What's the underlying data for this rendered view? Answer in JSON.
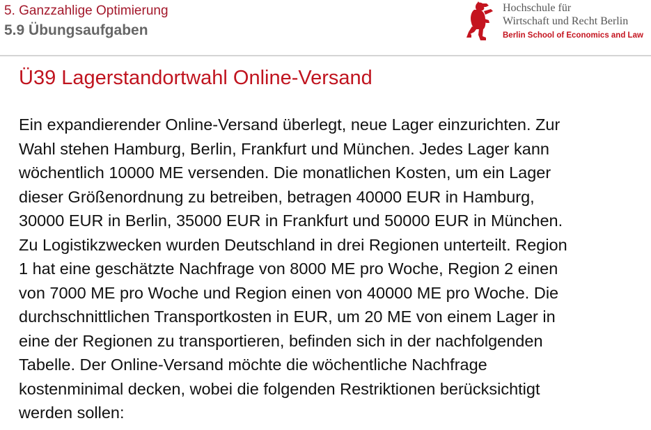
{
  "header": {
    "chapter": "5. Ganzzahlige Optimierung",
    "section": "5.9 Übungsaufgaben",
    "logo_icon": "berlin-bear-icon",
    "logo_color": "#c4141f",
    "university_line1": "Hochschule für",
    "university_line2": "Wirtschaft und Recht Berlin",
    "university_line3": "Berlin School of Economics and Law"
  },
  "main": {
    "title": "Ü39 Lagerstandortwahl Online-Versand",
    "lines": [
      "Ein expandierender Online-Versand überlegt, neue Lager einzurichten. Zur",
      "Wahl stehen Hamburg, Berlin, Frankfurt und München. Jedes Lager kann",
      "wöchentlich 10000 ME versenden. Die monatlichen Kosten, um ein Lager",
      "dieser Größenordnung zu betreiben, betragen 40000 EUR in Hamburg,",
      "30000 EUR in Berlin, 35000 EUR in Frankfurt und 50000 EUR in München.",
      "Zu Logistikzwecken wurden Deutschland in drei Regionen unterteilt. Region",
      "1 hat eine geschätzte Nachfrage von 8000 ME pro Woche, Region 2 einen",
      "von 7000 ME pro Woche und Region einen von 40000 ME pro Woche. Die",
      "durchschnittlichen Transportkosten in EUR, um 20 ME von einem Lager in",
      "eine der Regionen zu transportieren, befinden sich in der nachfolgenden",
      "Tabelle. Der Online-Versand möchte die wöchentliche Nachfrage",
      "kostenminimal decken, wobei die folgenden Restriktionen berücksichtigt",
      "werden sollen:"
    ]
  },
  "colors": {
    "accent_red": "#c0141f",
    "chapter_red": "#a3182b",
    "section_gray": "#666666"
  }
}
